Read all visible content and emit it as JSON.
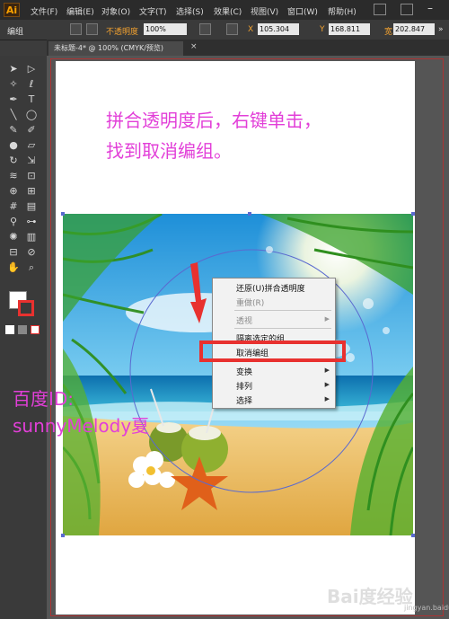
{
  "app": {
    "logo": "Ai"
  },
  "menubar": {
    "items": [
      "文件(F)",
      "编辑(E)",
      "对象(O)",
      "文字(T)",
      "选择(S)",
      "效果(C)",
      "视图(V)",
      "窗口(W)",
      "帮助(H)"
    ]
  },
  "control": {
    "group_label": "编组",
    "opacity_label": "不透明度",
    "opacity_value": "100%",
    "x_label": "X",
    "x_value": "105.304",
    "y_label": "Y",
    "y_value": "168.811",
    "w_label": "宽",
    "w_value": "202.847"
  },
  "document": {
    "tab": "未标题-4* @ 100% (CMYK/预览)"
  },
  "instruction": {
    "line1": "拼合透明度后，右键单击，",
    "line2": "找到取消编组。"
  },
  "context_menu": {
    "items": [
      {
        "label": "还原(U)拼合透明度",
        "enabled": true
      },
      {
        "label": "重做(R)",
        "enabled": false
      },
      {
        "label": "透视",
        "enabled": false,
        "submenu": true
      },
      {
        "label": "隔离选定的组",
        "enabled": true
      },
      {
        "label": "取消编组",
        "enabled": true
      },
      {
        "label": "变换",
        "enabled": true,
        "submenu": true
      },
      {
        "label": "排列",
        "enabled": true,
        "submenu": true
      },
      {
        "label": "选择",
        "enabled": true,
        "submenu": true
      }
    ]
  },
  "side_text": {
    "line1": "百度ID:",
    "line2": "sunnyMelody夏"
  },
  "watermark": {
    "brand": "Bai度经验",
    "url": "jingyan.baidu.com"
  },
  "colors": {
    "annotation": "#e23fd8",
    "highlight": "#e8312f",
    "arrow": "#e8312f"
  },
  "tool_icons": [
    "selection-icon",
    "direct-selection-icon",
    "magic-wand-icon",
    "lasso-icon",
    "pen-icon",
    "type-icon",
    "line-icon",
    "ellipse-icon",
    "paintbrush-icon",
    "pencil-icon",
    "blob-brush-icon",
    "eraser-icon",
    "rotate-icon",
    "scale-icon",
    "width-icon",
    "free-transform-icon",
    "shape-builder-icon",
    "perspective-grid-icon",
    "mesh-icon",
    "gradient-icon",
    "eyedropper-icon",
    "blend-icon",
    "symbol-sprayer-icon",
    "graph-icon",
    "artboard-icon",
    "slice-icon",
    "hand-icon",
    "zoom-icon"
  ]
}
